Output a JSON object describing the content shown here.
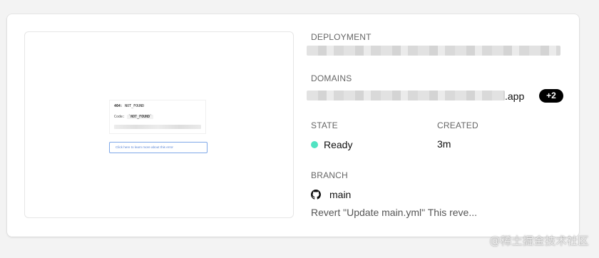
{
  "preview": {
    "error_code": "404",
    "error_name": "NOT_FOUND",
    "code_label": "Code:",
    "code_value": "NOT_FOUND",
    "link_text": "Click here to learn more about this error"
  },
  "deployment": {
    "label": "DEPLOYMENT"
  },
  "domains": {
    "label": "DOMAINS",
    "suffix": ".app",
    "extra_count": "+2"
  },
  "state": {
    "label": "STATE",
    "value": "Ready",
    "color": "#50e3c2"
  },
  "created": {
    "label": "CREATED",
    "value": "3m"
  },
  "branch": {
    "label": "BRANCH",
    "value": "main",
    "icon": "github-icon",
    "commit_message": "Revert \"Update main.yml\" This reve..."
  },
  "watermark": "@稀土掘金技术社区"
}
